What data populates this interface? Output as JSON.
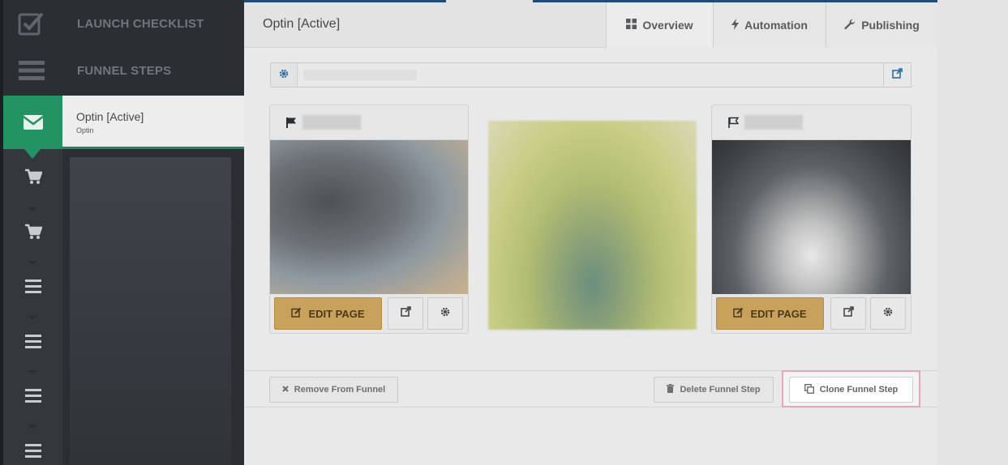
{
  "sidebar": {
    "launch_checklist": "LAUNCH CHECKLIST",
    "funnel_steps": "FUNNEL STEPS",
    "active_step": {
      "title": "Optin [Active]",
      "subtitle": "Optin"
    },
    "step_icons": [
      "envelope-icon",
      "cart-icon",
      "cart-icon",
      "bars-icon",
      "bars-icon",
      "bars-icon",
      "bars-icon"
    ]
  },
  "header": {
    "page_title": "Optin [Active]",
    "tabs": [
      {
        "label": "Overview",
        "icon": "grid-icon"
      },
      {
        "label": "Automation",
        "icon": "bolt-icon"
      },
      {
        "label": "Publishing",
        "icon": "wrench-icon"
      }
    ]
  },
  "editor": {
    "edit_page_label": "EDIT PAGE"
  },
  "actions": {
    "remove": "Remove From Funnel",
    "delete": "Delete Funnel Step",
    "clone": "Clone Funnel Step"
  },
  "colors": {
    "accent_green": "#239364",
    "edit_button": "#c8a25c",
    "header_blue": "#214c79",
    "highlight_border": "#e5a7b6"
  }
}
